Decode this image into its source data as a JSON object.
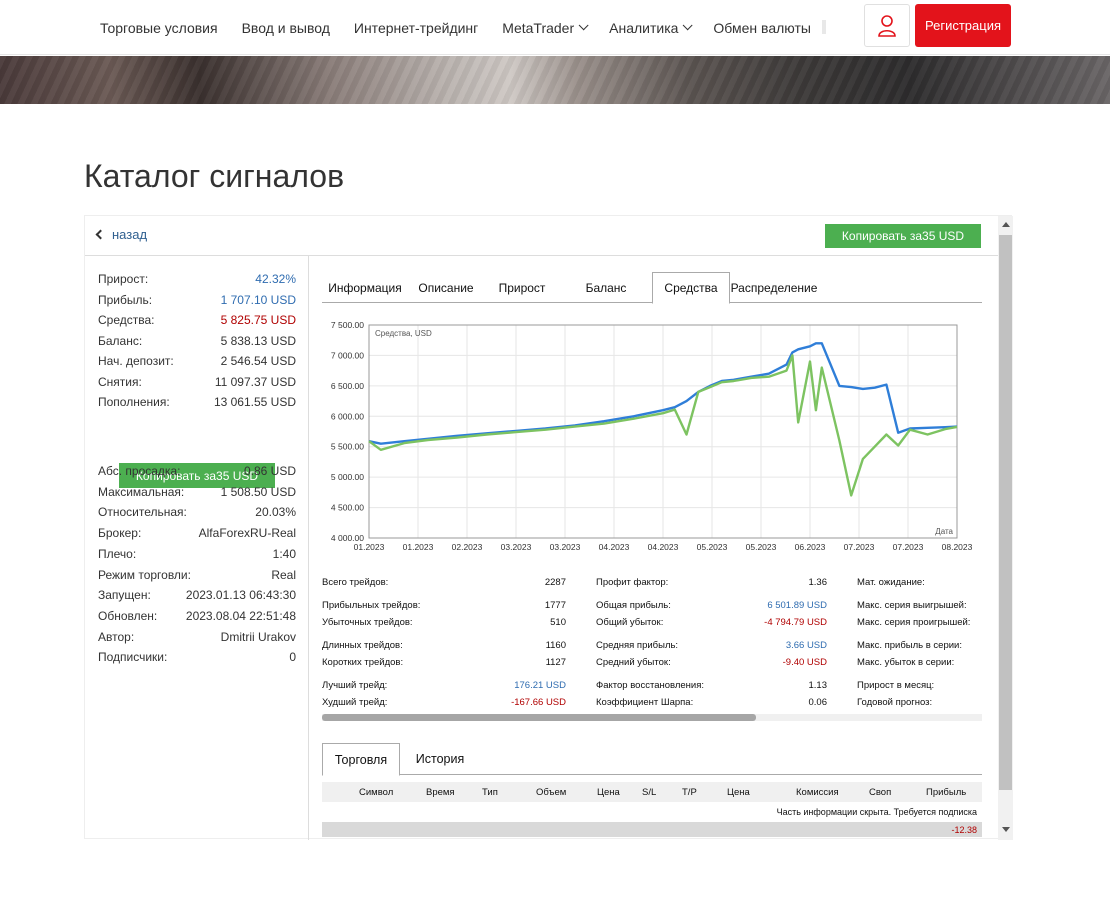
{
  "nav": {
    "items": [
      {
        "label": "Торговые условия",
        "dropdown": false
      },
      {
        "label": "Ввод и вывод",
        "dropdown": false
      },
      {
        "label": "Интернет-трейдинг",
        "dropdown": false
      },
      {
        "label": "MetaTrader",
        "dropdown": true
      },
      {
        "label": "Аналитика",
        "dropdown": true
      },
      {
        "label": "Обмен валюты",
        "dropdown": false
      }
    ],
    "register_label": "Регистрация",
    "user_icon": "user-icon",
    "accent_color": "#e3131b"
  },
  "page": {
    "title": "Каталог сигналов"
  },
  "signal": {
    "back_label": "назад",
    "copy_label": "Копировать за35  USD",
    "stats_top": [
      {
        "label": "Прирост:",
        "value": "42.32%",
        "color": "blue"
      },
      {
        "label": "Прибыль:",
        "value": "1 707.10 USD",
        "color": "blue"
      },
      {
        "label": "Средства:",
        "value": "5 825.75 USD",
        "color": "red"
      },
      {
        "label": "Баланс:",
        "value": "5 838.13 USD",
        "color": ""
      },
      {
        "label": "Нач. депозит:",
        "value": "2 546.54 USD",
        "color": ""
      },
      {
        "label": "Снятия:",
        "value": "11 097.37 USD",
        "color": ""
      },
      {
        "label": "Пополнения:",
        "value": "13 061.55 USD",
        "color": ""
      }
    ],
    "stats_bottom": [
      {
        "label": "Абс. просадка:",
        "value": "0.86 USD"
      },
      {
        "label": "Максимальная:",
        "value": "1 508.50 USD"
      },
      {
        "label": "Относительная:",
        "value": "20.03%"
      },
      {
        "label": "Брокер:",
        "value": "AlfaForexRU-Real"
      },
      {
        "label": "Плечо:",
        "value": "1:40"
      },
      {
        "label": "Режим торговли:",
        "value": "Real"
      },
      {
        "label": "Запущен:",
        "value": "2023.01.13 06:43:30"
      },
      {
        "label": "Обновлен:",
        "value": "2023.08.04 22:51:48"
      },
      {
        "label": "Автор:",
        "value": "Dmitrii Urakov"
      },
      {
        "label": "Подписчики:",
        "value": "0"
      }
    ],
    "tabs": [
      "Информация",
      "Описание",
      "Прирост",
      "Баланс",
      "Средства",
      "Распределение"
    ],
    "active_tab": "Средства",
    "metrics": {
      "col1": [
        {
          "label": "Всего трейдов:",
          "value": "2287"
        },
        {
          "label": "Прибыльных трейдов:",
          "value": "1777"
        },
        {
          "label": "Убыточных трейдов:",
          "value": "510"
        },
        {
          "label": "Длинных трейдов:",
          "value": "1160"
        },
        {
          "label": "Коротких трейдов:",
          "value": "1127"
        },
        {
          "label": "Лучший трейд:",
          "value": "176.21 USD",
          "color": "blue"
        },
        {
          "label": "Худший трейд:",
          "value": "-167.66 USD",
          "color": "red"
        }
      ],
      "col2": [
        {
          "label": "Профит фактор:",
          "value": "1.36"
        },
        {
          "label": "Общая прибыль:",
          "value": "6 501.89 USD",
          "color": "blue"
        },
        {
          "label": "Общий убыток:",
          "value": "-4 794.79 USD",
          "color": "red"
        },
        {
          "label": "Средняя прибыль:",
          "value": "3.66 USD",
          "color": "blue"
        },
        {
          "label": "Средний убыток:",
          "value": "-9.40 USD",
          "color": "red"
        },
        {
          "label": "Фактор восстановления:",
          "value": "1.13"
        },
        {
          "label": "Коэффициент Шарпа:",
          "value": "0.06"
        }
      ],
      "col3": [
        {
          "label": "Мат. ожидание:"
        },
        {
          "label": "Макс. серия выигрышей:"
        },
        {
          "label": "Макс. серия проигрышей:"
        },
        {
          "label": "Макс. прибыль в серии:"
        },
        {
          "label": "Макс. убыток в серии:"
        },
        {
          "label": "Прирост в месяц:"
        },
        {
          "label": "Годовой прогноз:"
        }
      ]
    },
    "bottom_tabs": [
      "Торговля",
      "История"
    ],
    "bottom_active": "Торговля",
    "trade_table": {
      "headers": [
        "Символ",
        "Время",
        "Тип",
        "Объем",
        "Цена",
        "S/L",
        "T/P",
        "Цена",
        "Комиссия",
        "Своп",
        "Прибыль"
      ],
      "note": "Часть информации скрыта. Требуется подписка",
      "total_profit": "-12.38"
    }
  },
  "chart_data": {
    "type": "line",
    "title": "Средства, USD",
    "xlabel": "Дата",
    "ylabel": "",
    "ylim": [
      4000,
      7500
    ],
    "y_ticks": [
      "4 000.00",
      "4 500.00",
      "5 000.00",
      "5 500.00",
      "6 000.00",
      "6 500.00",
      "7 000.00",
      "7 500.00"
    ],
    "x_ticks": [
      "01.2023",
      "01.2023",
      "02.2023",
      "03.2023",
      "03.2023",
      "04.2023",
      "04.2023",
      "05.2023",
      "05.2023",
      "06.2023",
      "07.2023",
      "07.2023",
      "08.2023"
    ],
    "grid": true,
    "colors": {
      "balance": "#2f7ed8",
      "equity": "#7dc361"
    },
    "x": [
      0,
      0.02,
      0.06,
      0.1,
      0.15,
      0.2,
      0.25,
      0.3,
      0.35,
      0.4,
      0.45,
      0.5,
      0.52,
      0.54,
      0.56,
      0.58,
      0.6,
      0.62,
      0.65,
      0.68,
      0.71,
      0.72,
      0.73,
      0.75,
      0.76,
      0.77,
      0.8,
      0.82,
      0.84,
      0.86,
      0.88,
      0.9,
      0.92,
      0.95,
      0.98,
      1.0
    ],
    "series": [
      {
        "values": [
          5590,
          5550,
          5590,
          5630,
          5680,
          5720,
          5760,
          5800,
          5850,
          5920,
          6000,
          6100,
          6150,
          6250,
          6400,
          6500,
          6580,
          6600,
          6650,
          6700,
          6850,
          7050,
          7100,
          7150,
          7200,
          7200,
          6500,
          6480,
          6450,
          6470,
          6520,
          5730,
          5800,
          5810,
          5820,
          5830
        ]
      },
      {
        "values": [
          5590,
          5450,
          5560,
          5610,
          5650,
          5700,
          5740,
          5780,
          5830,
          5880,
          5960,
          6050,
          6110,
          5700,
          6400,
          6480,
          6560,
          6580,
          6630,
          6650,
          6750,
          7000,
          5900,
          6900,
          6100,
          6800,
          5600,
          4700,
          5300,
          5500,
          5700,
          5520,
          5780,
          5700,
          5790,
          5826
        ]
      }
    ]
  }
}
